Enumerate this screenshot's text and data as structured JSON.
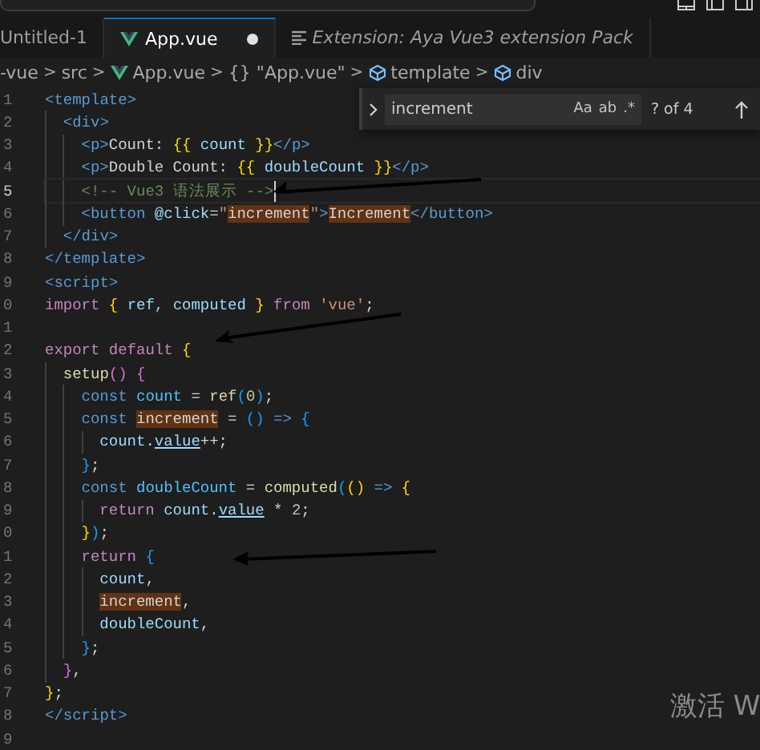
{
  "tabs": [
    {
      "label": "Untitled-1",
      "selected": false,
      "modified": false,
      "preview": false,
      "kind": "plain"
    },
    {
      "label": "App.vue",
      "selected": true,
      "modified": true,
      "preview": false,
      "kind": "vue"
    },
    {
      "label": "Extension: Aya Vue3 extension Pack",
      "selected": false,
      "modified": false,
      "preview": true,
      "kind": "doc"
    }
  ],
  "breadcrumb": [
    {
      "kind": "folder",
      "label": "-vue"
    },
    {
      "kind": "separator",
      "label": ">"
    },
    {
      "kind": "folder",
      "label": "src"
    },
    {
      "kind": "separator",
      "label": ">"
    },
    {
      "kind": "vue",
      "label": "App.vue"
    },
    {
      "kind": "separator",
      "label": ">"
    },
    {
      "kind": "folder",
      "label": "{} \"App.vue\""
    },
    {
      "kind": "separator",
      "label": ">"
    },
    {
      "kind": "cube",
      "label": "template"
    },
    {
      "kind": "separator",
      "label": ">"
    },
    {
      "kind": "cube",
      "label": "div"
    }
  ],
  "find_widget": {
    "value": "increment",
    "options": [
      "Aa",
      "ab",
      ".*"
    ],
    "result": "? of 4"
  },
  "editor": {
    "lines": [
      {
        "number": "1",
        "current": false,
        "tokens": [
          {
            "kind": "tag",
            "text": "<template>"
          }
        ]
      },
      {
        "number": "2",
        "current": false,
        "tokens": [
          {
            "kind": "tag",
            "text": "  <div>"
          }
        ]
      },
      {
        "number": "3",
        "current": false,
        "tokens": [
          {
            "kind": "tag",
            "text": "    <p>"
          },
          {
            "kind": "text",
            "text": "Count: "
          },
          {
            "kind": "brace",
            "text": "{{"
          },
          {
            "kind": "ident",
            "text": " count "
          },
          {
            "kind": "brace",
            "text": "}}"
          },
          {
            "kind": "tag",
            "text": "</p>"
          }
        ]
      },
      {
        "number": "4",
        "current": false,
        "tokens": [
          {
            "kind": "tag",
            "text": "    <p>"
          },
          {
            "kind": "text",
            "text": "Double Count: "
          },
          {
            "kind": "brace",
            "text": "{{"
          },
          {
            "kind": "ident",
            "text": " doubleCount "
          },
          {
            "kind": "brace",
            "text": "}}"
          },
          {
            "kind": "tag",
            "text": "</p>"
          }
        ]
      },
      {
        "number": "5",
        "current": true,
        "tokens": [
          {
            "kind": "comment",
            "text": "    <!-- Vue3 语法展示 -->"
          }
        ]
      },
      {
        "number": "6",
        "current": false,
        "tokens": [
          {
            "kind": "tag",
            "text": "    <button "
          },
          {
            "kind": "ident",
            "text": "@click"
          },
          {
            "kind": "text",
            "text": "="
          },
          {
            "kind": "string",
            "text": "\""
          },
          {
            "kind": "match",
            "text": "increment"
          },
          {
            "kind": "string",
            "text": "\""
          },
          {
            "kind": "tag",
            "text": ">"
          },
          {
            "kind": "match",
            "text": "Increment"
          },
          {
            "kind": "tag",
            "text": "</button>"
          }
        ]
      },
      {
        "number": "7",
        "current": false,
        "tokens": [
          {
            "kind": "tag",
            "text": "  </div>"
          }
        ]
      },
      {
        "number": "8",
        "current": false,
        "tokens": [
          {
            "kind": "tag",
            "text": "</template>"
          }
        ]
      },
      {
        "number": "9",
        "current": false,
        "tokens": [
          {
            "kind": "tag",
            "text": "<script>"
          }
        ]
      },
      {
        "number": "0",
        "current": false,
        "tokens": [
          {
            "kind": "keyword",
            "text": "import "
          },
          {
            "kind": "brace",
            "text": "{"
          },
          {
            "kind": "ident",
            "text": " ref, computed "
          },
          {
            "kind": "brace",
            "text": "}"
          },
          {
            "kind": "keyword",
            "text": " from "
          },
          {
            "kind": "string",
            "text": "'vue'"
          },
          {
            "kind": "text",
            "text": ";"
          }
        ]
      },
      {
        "number": "1",
        "current": false
      },
      {
        "number": "2",
        "current": false,
        "tokens": [
          {
            "kind": "keyword",
            "text": "export default "
          },
          {
            "kind": "brace",
            "text": "{"
          }
        ]
      },
      {
        "number": "3",
        "current": false,
        "tokens": [
          {
            "kind": "func",
            "text": "  setup"
          },
          {
            "kind": "purple",
            "text": "() {"
          }
        ]
      },
      {
        "number": "4",
        "current": false,
        "tokens": [
          {
            "kind": "storage",
            "text": "    const "
          },
          {
            "kind": "constant",
            "text": "count"
          },
          {
            "kind": "text",
            "text": " = "
          },
          {
            "kind": "func",
            "text": "ref"
          },
          {
            "kind": "blue",
            "text": "("
          },
          {
            "kind": "number",
            "text": "0"
          },
          {
            "kind": "blue",
            "text": ")"
          },
          {
            "kind": "text",
            "text": ";"
          }
        ]
      },
      {
        "number": "5",
        "current": false,
        "tokens": [
          {
            "kind": "storage",
            "text": "    const "
          },
          {
            "kind": "match",
            "text": "increment"
          },
          {
            "kind": "text",
            "text": " = "
          },
          {
            "kind": "blue",
            "text": "()"
          },
          {
            "kind": "storage",
            "text": " => "
          },
          {
            "kind": "blue",
            "text": "{"
          }
        ]
      },
      {
        "number": "6",
        "current": false,
        "tokens": [
          {
            "kind": "ident",
            "text": "      count"
          },
          {
            "kind": "text",
            "text": "."
          },
          {
            "kind": "underlined",
            "text": "value"
          },
          {
            "kind": "text",
            "text": "++;"
          }
        ]
      },
      {
        "number": "7",
        "current": false,
        "tokens": [
          {
            "kind": "blue",
            "text": "    }"
          },
          {
            "kind": "text",
            "text": ";"
          }
        ]
      },
      {
        "number": "8",
        "current": false,
        "tokens": [
          {
            "kind": "storage",
            "text": "    const "
          },
          {
            "kind": "constant",
            "text": "doubleCount"
          },
          {
            "kind": "text",
            "text": " = "
          },
          {
            "kind": "func",
            "text": "computed"
          },
          {
            "kind": "blue",
            "text": "("
          },
          {
            "kind": "brace",
            "text": "()"
          },
          {
            "kind": "storage",
            "text": " => "
          },
          {
            "kind": "brace",
            "text": "{"
          }
        ]
      },
      {
        "number": "9",
        "current": false,
        "tokens": [
          {
            "kind": "keyword",
            "text": "      return "
          },
          {
            "kind": "ident",
            "text": "count"
          },
          {
            "kind": "text",
            "text": "."
          },
          {
            "kind": "underlined",
            "text": "value"
          },
          {
            "kind": "text",
            "text": " * "
          },
          {
            "kind": "number",
            "text": "2"
          },
          {
            "kind": "text",
            "text": ";"
          }
        ]
      },
      {
        "number": "0",
        "current": false,
        "tokens": [
          {
            "kind": "brace",
            "text": "    }"
          },
          {
            "kind": "blue",
            "text": ")"
          },
          {
            "kind": "text",
            "text": ";"
          }
        ]
      },
      {
        "number": "1",
        "current": false,
        "tokens": [
          {
            "kind": "keyword",
            "text": "    return "
          },
          {
            "kind": "blue",
            "text": "{"
          }
        ]
      },
      {
        "number": "2",
        "current": false,
        "tokens": [
          {
            "kind": "ident",
            "text": "      count"
          },
          {
            "kind": "text",
            "text": ","
          }
        ]
      },
      {
        "number": "3",
        "current": false,
        "tokens": [
          {
            "kind": "match",
            "text": "      increment"
          },
          {
            "kind": "text",
            "text": ","
          }
        ]
      },
      {
        "number": "4",
        "current": false,
        "tokens": [
          {
            "kind": "ident",
            "text": "      doubleCount"
          },
          {
            "kind": "text",
            "text": ","
          }
        ]
      },
      {
        "number": "5",
        "current": false,
        "tokens": [
          {
            "kind": "blue",
            "text": "    }"
          },
          {
            "kind": "text",
            "text": ";"
          }
        ]
      },
      {
        "number": "6",
        "current": false,
        "tokens": [
          {
            "kind": "purple",
            "text": "  }"
          },
          {
            "kind": "text",
            "text": ","
          }
        ]
      },
      {
        "number": "7",
        "current": false,
        "tokens": [
          {
            "kind": "brace",
            "text": "}"
          },
          {
            "kind": "text",
            "text": ";"
          }
        ]
      },
      {
        "number": "8",
        "current": false,
        "tokens": [
          {
            "kind": "tag",
            "text": "</script>"
          }
        ]
      },
      {
        "number": "9",
        "current": false
      }
    ]
  },
  "os_watermark": "激活 W"
}
